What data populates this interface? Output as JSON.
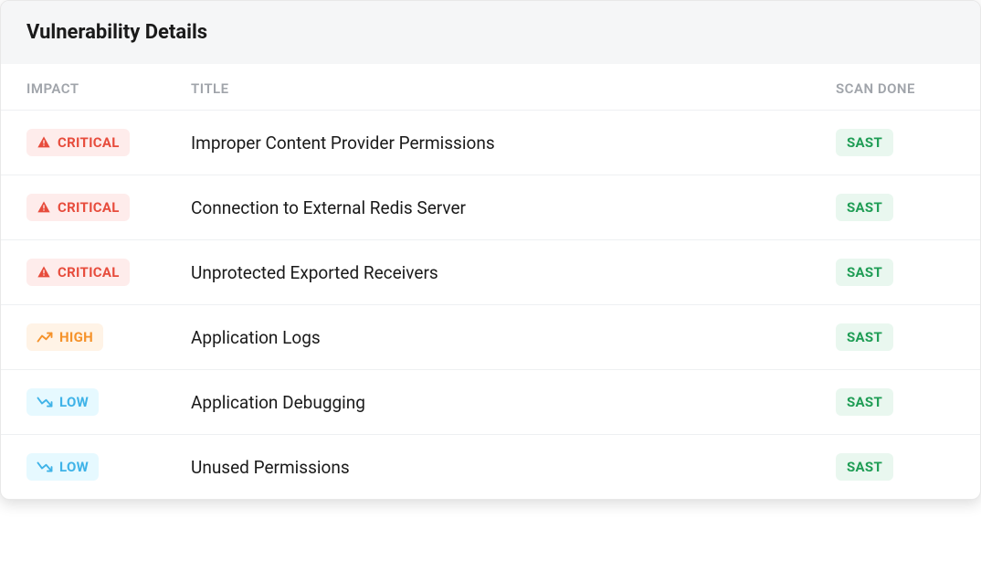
{
  "panel": {
    "title": "Vulnerability Details"
  },
  "columns": {
    "impact": "IMPACT",
    "title": "TITLE",
    "scan": "SCAN DONE"
  },
  "severity_labels": {
    "critical": "CRITICAL",
    "high": "HIGH",
    "low": "LOW"
  },
  "scan_labels": {
    "sast": "SAST"
  },
  "rows": [
    {
      "severity": "critical",
      "title": "Improper Content Provider Permissions",
      "scan": "sast"
    },
    {
      "severity": "critical",
      "title": "Connection to External Redis Server",
      "scan": "sast"
    },
    {
      "severity": "critical",
      "title": "Unprotected Exported Receivers",
      "scan": "sast"
    },
    {
      "severity": "high",
      "title": "Application Logs",
      "scan": "sast"
    },
    {
      "severity": "low",
      "title": "Application Debugging",
      "scan": "sast"
    },
    {
      "severity": "low",
      "title": "Unused Permissions",
      "scan": "sast"
    }
  ]
}
